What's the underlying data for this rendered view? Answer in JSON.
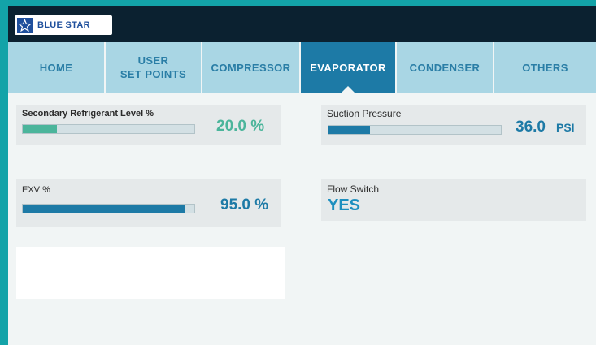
{
  "brand": {
    "name": "BLUE STAR",
    "logo_icon": "star-icon",
    "color": "#1e4f9c"
  },
  "nav": {
    "tabs": [
      {
        "label": "HOME",
        "active": false
      },
      {
        "label": "USER\nSET POINTS",
        "active": false
      },
      {
        "label": "COMPRESSOR",
        "active": false
      },
      {
        "label": "EVAPORATOR",
        "active": true
      },
      {
        "label": "CONDENSER",
        "active": false
      },
      {
        "label": "OTHERS",
        "active": false
      }
    ]
  },
  "readings": {
    "secondary_refrigerant": {
      "label": "Secondary Refrigerant Level %",
      "value": "20.0 %",
      "level_percent": 20,
      "color": "#4bb59b"
    },
    "suction_pressure": {
      "label": "Suction Pressure",
      "value": "36.0",
      "unit": "PSI",
      "level_fraction": 0.24,
      "color": "#1d7aa6"
    },
    "exv": {
      "label": "EXV %",
      "value": "95.0 %",
      "level_percent": 95,
      "color": "#1d7aa6"
    },
    "flow_switch": {
      "label": "Flow Switch",
      "value": "YES",
      "color": "#1d8fbf"
    }
  },
  "colors": {
    "background_frame": "#13a3a8",
    "topbar": "#0b2130",
    "tab_inactive": "#a9d6e4",
    "tab_active": "#1d7aa6"
  }
}
